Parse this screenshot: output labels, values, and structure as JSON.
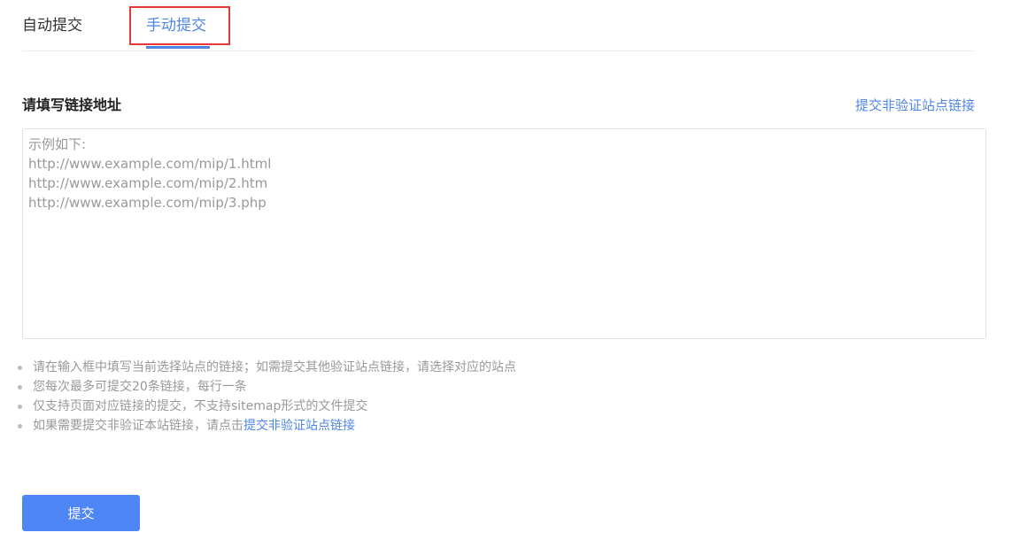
{
  "tabs": {
    "auto_label": "自动提交",
    "manual_label": "手动提交",
    "active": "manual"
  },
  "form": {
    "title": "请填写链接地址",
    "nonverified_link": "提交非验证站点链接",
    "textarea_value": "",
    "textarea_placeholder": "示例如下:\nhttp://www.example.com/mip/1.html\nhttp://www.example.com/mip/2.htm\nhttp://www.example.com/mip/3.php"
  },
  "tips": [
    {
      "text": "请在输入框中填写当前选择站点的链接；如需提交其他验证站点链接，请选择对应的站点"
    },
    {
      "text": "您每次最多可提交20条链接，每行一条"
    },
    {
      "text": "仅支持页面对应链接的提交，不支持sitemap形式的文件提交"
    },
    {
      "text": "如果需要提交非验证本站链接，请点击",
      "link": "提交非验证站点链接"
    }
  ],
  "submit_label": "提交",
  "colors": {
    "accent": "#4e86e8",
    "button": "#4e86f5",
    "highlight": "#e53935",
    "muted_text": "#999999"
  }
}
